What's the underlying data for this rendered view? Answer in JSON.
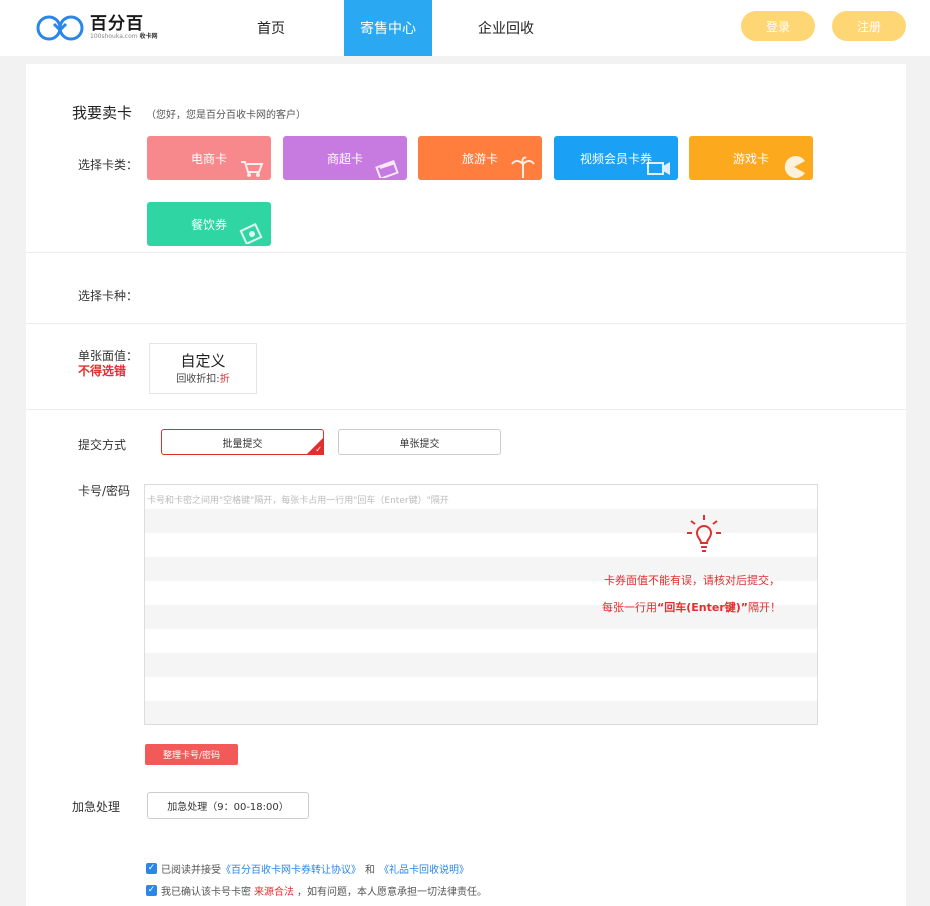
{
  "header": {
    "logo_name": "百分百",
    "logo_sub_a": "100shouka.com",
    "logo_sub_b": "收卡网",
    "nav": [
      "首页",
      "寄售中心",
      "企业回收"
    ],
    "login": "登录",
    "register": "注册"
  },
  "sell": {
    "title": "我要卖卡",
    "note": "（您好，您是百分百收卡网的客户）",
    "card_category_label": "选择卡类：",
    "categories": [
      {
        "label": "电商卡",
        "color": "#f7898c"
      },
      {
        "label": "商超卡",
        "color": "#c77ae0"
      },
      {
        "label": "旅游卡",
        "color": "#ff7d3d"
      },
      {
        "label": "视频会员卡券",
        "color": "#1aa0f5"
      },
      {
        "label": "游戏卡",
        "color": "#fda91e"
      },
      {
        "label": "餐饮券",
        "color": "#2fd6a3"
      }
    ],
    "card_kind_label": "选择卡种：",
    "face_value_label": "单张面值：",
    "face_value_warn": "不得选错",
    "custom_title": "自定义",
    "custom_sub_a": "回收折扣:",
    "custom_sub_b": "折",
    "submit_label": "提交方式",
    "batch": "批量提交",
    "single": "单张提交",
    "card_pwd_label": "卡号/密码",
    "placeholder": "卡号和卡密之间用\"空格键\"隔开，每张卡占用一行用\"回车（Enter键）\"隔开",
    "tip1": "卡券面值不能有误，请核对后提交，",
    "tip2_a": "每张一行用",
    "tip2_b": "“回车(Enter键)”",
    "tip2_c": "隔开！",
    "tidy_button": "整理卡号/密码",
    "urgent_label": "加急处理",
    "urgent_button": "加急处理（9：00-18:00）",
    "agree1_a": "已阅读并接受",
    "agree1_link1": "《百分百收卡网卡券转让协议》",
    "agree1_and": "和",
    "agree1_link2": "《礼品卡回收说明》",
    "agree2_a": "我已确认该卡号卡密",
    "agree2_red": "来源合法",
    "agree2_b": "，如有问题，本人愿意承担一切法律责任。"
  },
  "colors": {
    "accent": "#2aa8f2",
    "button_yellow": "#ffd674",
    "warn_red": "#e0302e"
  }
}
